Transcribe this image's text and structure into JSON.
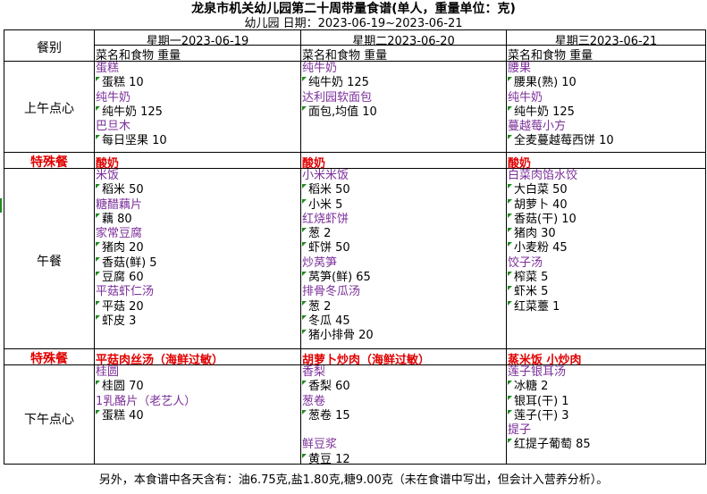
{
  "header": {
    "title": "龙泉市机关幼儿园第二十周带量食谱(单人，重量单位：克)",
    "subtitle": "幼儿园 日期：2023-06-19~2023-06-21"
  },
  "table": {
    "meal_column_header": "餐别",
    "column_subheader": "菜名和食物    重量",
    "days": [
      "星期一2023-06-19",
      "星期二2023-06-20",
      "星期三2023-06-21"
    ],
    "rows": [
      {
        "label": "上午点心",
        "cells": [
          [
            {
              "t": "dish",
              "v": "蛋糕"
            },
            {
              "t": "ing",
              "v": "蛋糕  10"
            },
            {
              "t": "dish",
              "v": "纯牛奶"
            },
            {
              "t": "ing",
              "v": "纯牛奶  125"
            },
            {
              "t": "dish",
              "v": "巴旦木"
            },
            {
              "t": "ing",
              "v": "每日坚果  10"
            }
          ],
          [
            {
              "t": "dish",
              "v": "纯牛奶"
            },
            {
              "t": "ing",
              "v": "纯牛奶  125"
            },
            {
              "t": "dish",
              "v": "达利园软面包"
            },
            {
              "t": "ing",
              "v": "面包,均值  10"
            }
          ],
          [
            {
              "t": "dish",
              "v": "腰果"
            },
            {
              "t": "ing",
              "v": "腰果(熟)  10"
            },
            {
              "t": "dish",
              "v": "纯牛奶"
            },
            {
              "t": "ing",
              "v": "纯牛奶  125"
            },
            {
              "t": "dish",
              "v": "蔓越莓小方"
            },
            {
              "t": "ing",
              "v": "全麦蔓越莓西饼  10"
            }
          ]
        ]
      },
      {
        "label": "午餐",
        "cells": [
          [
            {
              "t": "dish",
              "v": "米饭"
            },
            {
              "t": "ing",
              "v": "稻米  50"
            },
            {
              "t": "dish",
              "v": "糖醋藕片"
            },
            {
              "t": "ing",
              "v": "藕  80"
            },
            {
              "t": "dish",
              "v": "家常豆腐"
            },
            {
              "t": "ing",
              "v": "猪肉  20"
            },
            {
              "t": "ing",
              "v": "香菇(鲜)  5"
            },
            {
              "t": "ing",
              "v": "豆腐  60"
            },
            {
              "t": "dish",
              "v": "平菇虾仁汤"
            },
            {
              "t": "ing",
              "v": "平菇  20"
            },
            {
              "t": "ing",
              "v": "虾皮  3"
            }
          ],
          [
            {
              "t": "dish",
              "v": "小米米饭"
            },
            {
              "t": "ing",
              "v": "稻米  50"
            },
            {
              "t": "ing",
              "v": "小米  5"
            },
            {
              "t": "dish",
              "v": "红烧虾饼"
            },
            {
              "t": "ing",
              "v": "葱  2"
            },
            {
              "t": "ing",
              "v": "虾饼  50"
            },
            {
              "t": "dish",
              "v": "炒莴笋"
            },
            {
              "t": "ing",
              "v": "莴笋(鲜)  65"
            },
            {
              "t": "dish",
              "v": "排骨冬瓜汤"
            },
            {
              "t": "ing",
              "v": "葱  2"
            },
            {
              "t": "ing",
              "v": "冬瓜  45"
            },
            {
              "t": "ing",
              "v": "猪小排骨  20"
            }
          ],
          [
            {
              "t": "dish",
              "v": "白菜肉馅水饺"
            },
            {
              "t": "ing",
              "v": "大白菜  50"
            },
            {
              "t": "ing",
              "v": "胡萝卜  40"
            },
            {
              "t": "ing",
              "v": "香菇(干)  10"
            },
            {
              "t": "ing",
              "v": "猪肉  30"
            },
            {
              "t": "ing",
              "v": "小麦粉  45"
            },
            {
              "t": "dish",
              "v": "饺子汤"
            },
            {
              "t": "ing",
              "v": "榨菜  5"
            },
            {
              "t": "ing",
              "v": "虾米  5"
            },
            {
              "t": "ing",
              "v": "红菜薹  1"
            }
          ]
        ]
      },
      {
        "label": "下午点心",
        "cells": [
          [
            {
              "t": "dish",
              "v": "桂圆"
            },
            {
              "t": "ing",
              "v": "桂圆  70"
            },
            {
              "t": "dish",
              "v": "1乳酪片（老艺人）"
            },
            {
              "t": "ing",
              "v": "蛋糕  40"
            }
          ],
          [
            {
              "t": "dish",
              "v": "香梨"
            },
            {
              "t": "ing",
              "v": "香梨  60"
            },
            {
              "t": "dish",
              "v": "葱卷"
            },
            {
              "t": "ing",
              "v": "葱卷  15"
            },
            {
              "t": "blank",
              "v": ""
            },
            {
              "t": "dish",
              "v": "鲜豆浆"
            },
            {
              "t": "ing",
              "v": "黄豆  12"
            }
          ],
          [
            {
              "t": "dish",
              "v": "莲子银耳汤"
            },
            {
              "t": "ing",
              "v": "冰糖  2"
            },
            {
              "t": "ing",
              "v": "银耳(干)  1"
            },
            {
              "t": "ing",
              "v": "莲子(干)  3"
            },
            {
              "t": "dish",
              "v": "提子"
            },
            {
              "t": "ing",
              "v": "红提子葡萄  85"
            }
          ]
        ]
      }
    ],
    "special_label": "特殊餐",
    "special_1": [
      "酸奶",
      "酸奶",
      "酸奶"
    ],
    "special_2": [
      "平菇肉丝汤（海鲜过敏）",
      "胡萝卜炒肉（海鲜过敏）",
      "蒸米饭  小炒肉"
    ]
  },
  "footer": "另外，本食谱中各天含有：油6.75克,盐1.80克,糖9.00克（未在食谱中写出，但会计入营养分析）。",
  "colors": {
    "dish": "#7b2f9a",
    "special": "#e00000",
    "marker": "#1f8a1f"
  }
}
